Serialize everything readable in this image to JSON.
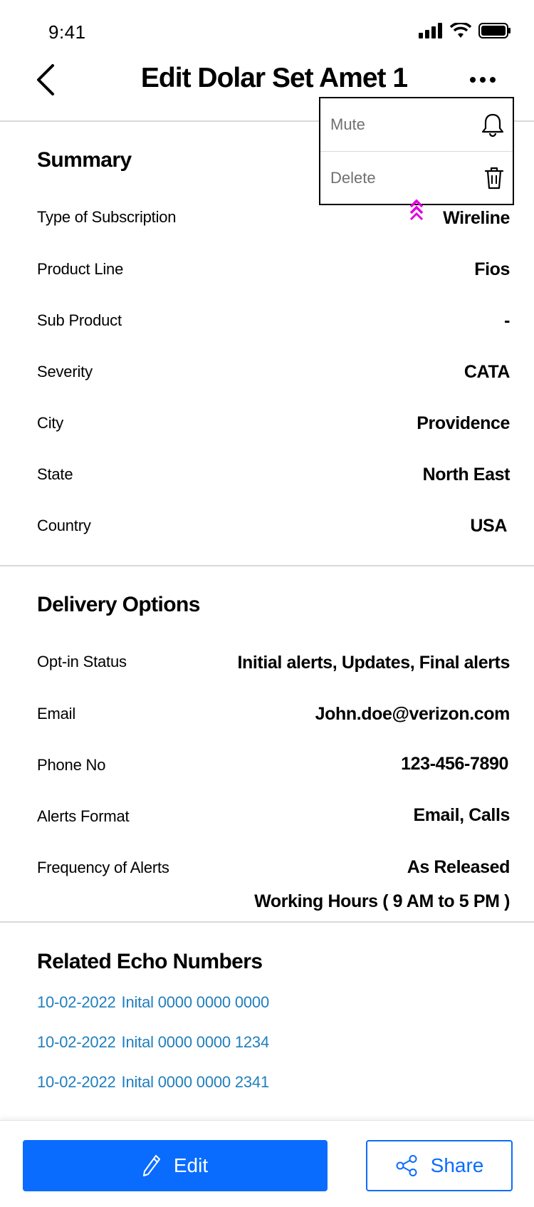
{
  "status_bar": {
    "time": "9:41"
  },
  "header": {
    "title": "Edit Dolar Set Amet 1"
  },
  "menu": {
    "items": [
      {
        "label": "Mute"
      },
      {
        "label": "Delete"
      }
    ]
  },
  "summary": {
    "title": "Summary",
    "rows": [
      {
        "label": "Type of Subscription",
        "value": "Wireline"
      },
      {
        "label": "Product Line",
        "value": "Fios"
      },
      {
        "label": "Sub Product",
        "value": "-"
      },
      {
        "label": "Severity",
        "value": "CATA"
      },
      {
        "label": "City",
        "value": "Providence"
      },
      {
        "label": "State",
        "value": "North East"
      },
      {
        "label": "Country",
        "value": "USA"
      }
    ]
  },
  "delivery": {
    "title": "Delivery Options",
    "rows": [
      {
        "label": "Opt-in Status",
        "value": "Initial alerts, Updates, Final alerts"
      },
      {
        "label": "Email",
        "value": "John.doe@verizon.com"
      },
      {
        "label": "Phone No",
        "value": "123-456-7890"
      },
      {
        "label": "Alerts Format",
        "value": "Email, Calls"
      },
      {
        "label": "Frequency of Alerts",
        "value": "As Released",
        "value2": "Working Hours ( 9 AM to 5 PM )"
      }
    ]
  },
  "related": {
    "title": "Related Echo Numbers",
    "links": [
      {
        "date": "10-02-2022",
        "text": "Inital 0000 0000 0000"
      },
      {
        "date": "10-02-2022",
        "text": "Inital 0000 0000 1234"
      },
      {
        "date": "10-02-2022",
        "text": "Inital 0000 0000 2341"
      }
    ]
  },
  "footer": {
    "edit_label": "Edit",
    "share_label": "Share"
  },
  "colors": {
    "primary": "#0a6cff",
    "link": "#1f7fbd",
    "indicator": "#e000e0",
    "divider": "#d8dada"
  }
}
